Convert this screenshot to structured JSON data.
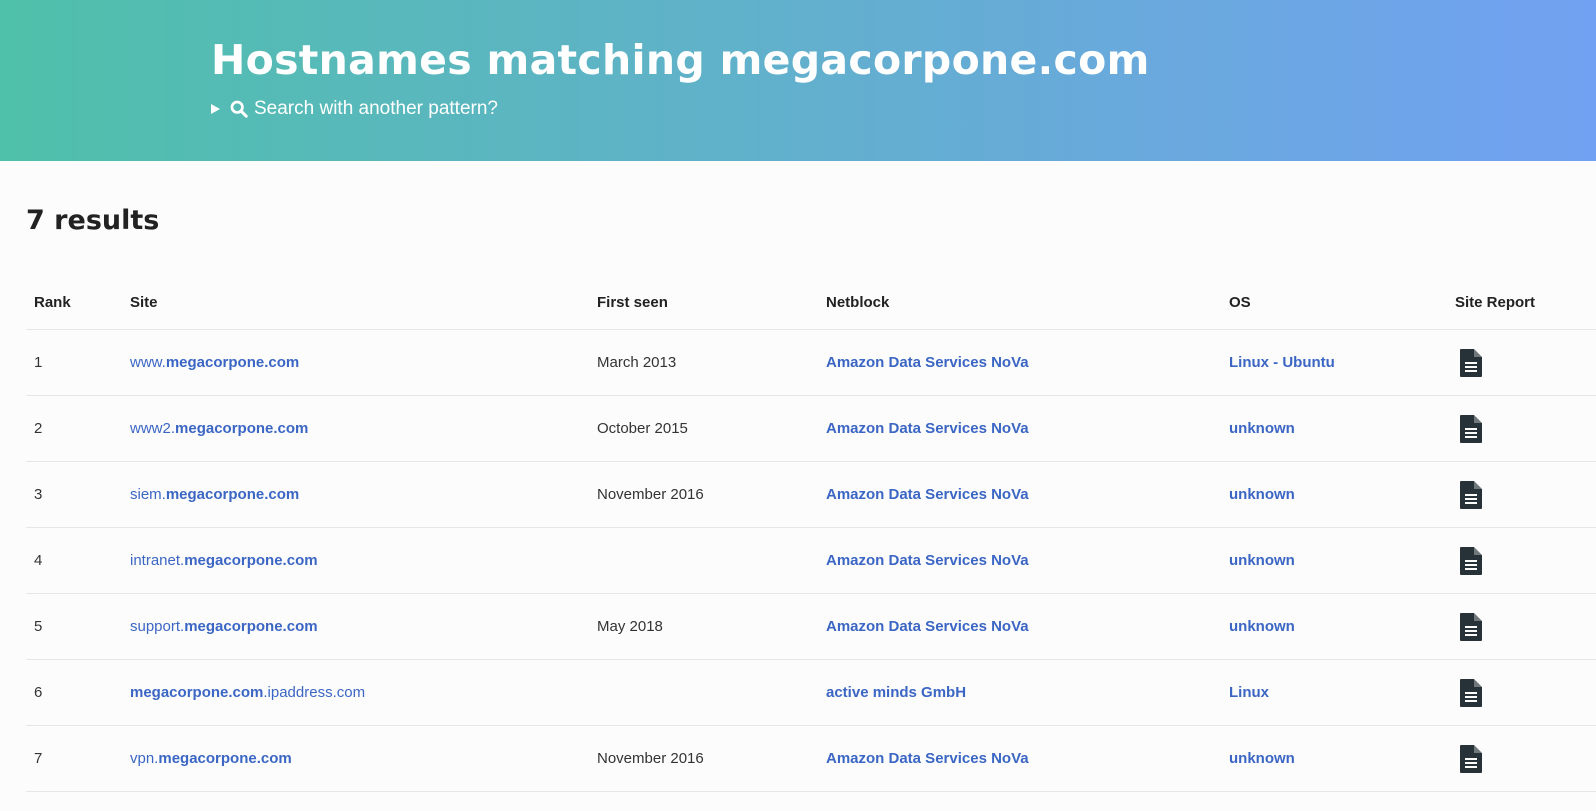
{
  "header": {
    "title": "Hostnames matching megacorpone.com",
    "search_toggle": "Search with another pattern?"
  },
  "results": {
    "count_label": "7 results"
  },
  "table": {
    "columns": [
      "Rank",
      "Site",
      "First seen",
      "Netblock",
      "OS",
      "Site Report"
    ],
    "rows": [
      {
        "rank": "1",
        "site_prefix": "www.",
        "site_bold": "megacorpone.com",
        "site_suffix": "",
        "first_seen": "March 2013",
        "netblock": "Amazon Data Services NoVa",
        "os": "Linux - Ubuntu",
        "report_icon": "document-icon"
      },
      {
        "rank": "2",
        "site_prefix": "www2.",
        "site_bold": "megacorpone.com",
        "site_suffix": "",
        "first_seen": "October 2015",
        "netblock": "Amazon Data Services NoVa",
        "os": "unknown",
        "report_icon": "document-icon"
      },
      {
        "rank": "3",
        "site_prefix": "siem.",
        "site_bold": "megacorpone.com",
        "site_suffix": "",
        "first_seen": "November 2016",
        "netblock": "Amazon Data Services NoVa",
        "os": "unknown",
        "report_icon": "document-icon"
      },
      {
        "rank": "4",
        "site_prefix": "intranet.",
        "site_bold": "megacorpone.com",
        "site_suffix": "",
        "first_seen": "",
        "netblock": "Amazon Data Services NoVa",
        "os": "unknown",
        "report_icon": "document-icon"
      },
      {
        "rank": "5",
        "site_prefix": "support.",
        "site_bold": "megacorpone.com",
        "site_suffix": "",
        "first_seen": "May 2018",
        "netblock": "Amazon Data Services NoVa",
        "os": "unknown",
        "report_icon": "document-icon"
      },
      {
        "rank": "6",
        "site_prefix": "",
        "site_bold": "megacorpone.com",
        "site_suffix": ".ipaddress.com",
        "first_seen": "",
        "netblock": "active minds GmbH",
        "os": "Linux",
        "report_icon": "document-icon"
      },
      {
        "rank": "7",
        "site_prefix": "vpn.",
        "site_bold": "megacorpone.com",
        "site_suffix": "",
        "first_seen": "November 2016",
        "netblock": "Amazon Data Services NoVa",
        "os": "unknown",
        "report_icon": "document-icon"
      }
    ]
  },
  "colors": {
    "gradient_start": "#4fc0aa",
    "gradient_end": "#71a1f2",
    "link": "#3b66c4"
  }
}
